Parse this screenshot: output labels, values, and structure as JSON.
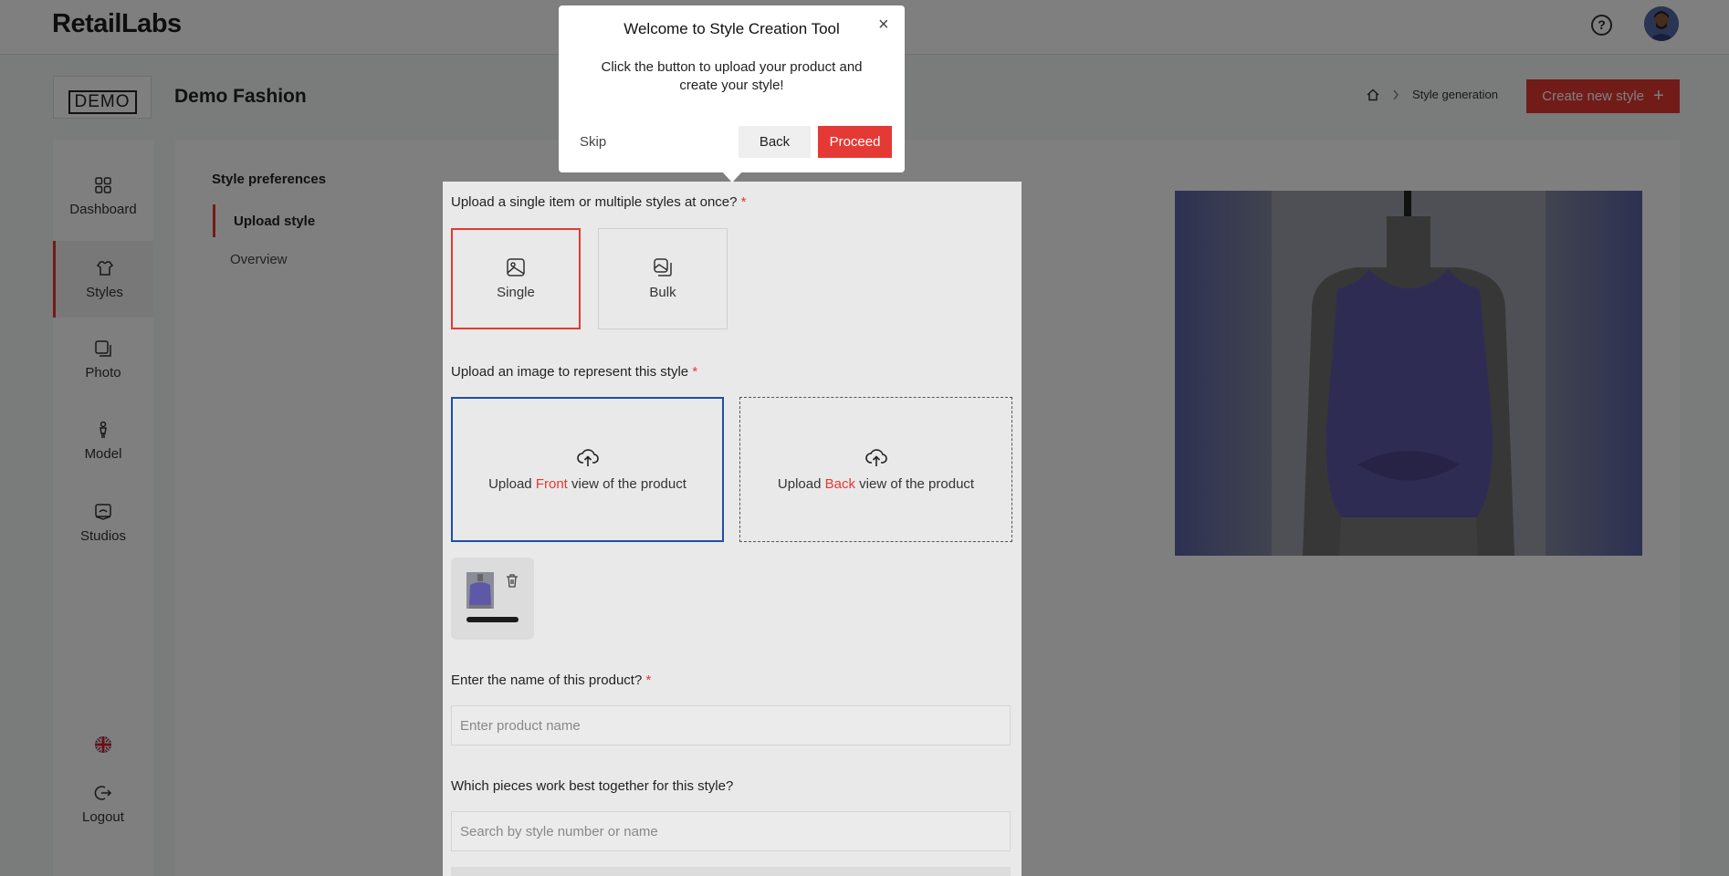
{
  "app": {
    "logo": "RetailLabs",
    "help_glyph": "?"
  },
  "header": {
    "demo_logo": "DEMO",
    "brand": "Demo Fashion",
    "breadcrumb_current": "Style generation",
    "create_label": "Create new style",
    "create_plus": "+"
  },
  "sidebar": {
    "items": [
      {
        "label": "Dashboard",
        "icon": "dashboard-icon"
      },
      {
        "label": "Styles",
        "icon": "styles-icon"
      },
      {
        "label": "Photo",
        "icon": "photo-icon"
      },
      {
        "label": "Model",
        "icon": "model-icon"
      },
      {
        "label": "Studios",
        "icon": "studios-icon"
      }
    ],
    "logout": "Logout"
  },
  "steps": {
    "title": "Style preferences",
    "items": [
      "Upload style",
      "Overview"
    ]
  },
  "form": {
    "q_type": "Upload a single item or multiple styles at once?",
    "required": "*",
    "type_single": "Single",
    "type_bulk": "Bulk",
    "q_image": "Upload an image to represent this style",
    "upload_prefix": "Upload",
    "front": "Front",
    "back": "Back",
    "upload_suffix": "view of the product",
    "q_name": "Enter the name of this product?",
    "name_placeholder": "Enter product name",
    "q_pieces": "Which pieces work best together for this style?",
    "pieces_placeholder": "Search by style number or name"
  },
  "tooltip": {
    "title": "Welcome to Style Creation Tool",
    "close": "×",
    "body": "Click the button to upload your product and create your style!",
    "skip": "Skip",
    "back": "Back",
    "proceed": "Proceed"
  },
  "colors": {
    "accent": "#e53935",
    "selected_blue": "#1e4fa8",
    "garment": "#5f58a8"
  }
}
